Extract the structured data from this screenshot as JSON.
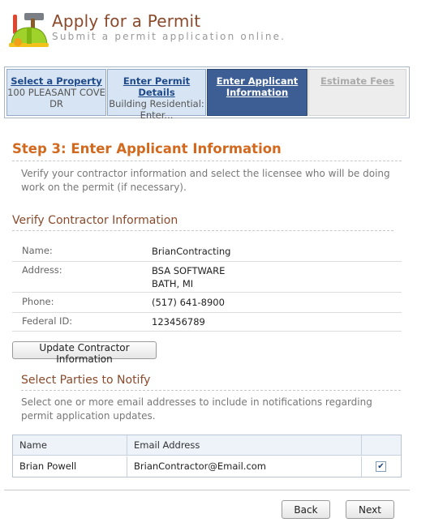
{
  "header": {
    "title": "Apply for a Permit",
    "subtitle": "Submit a permit application online."
  },
  "wizard": {
    "steps": [
      {
        "label": "Select a Property",
        "sub": "100 PLEASANT COVE DR",
        "state": "done"
      },
      {
        "label": "Enter Permit Details",
        "sub": "Building Residential: Enter...",
        "state": "done"
      },
      {
        "label": "Enter Applicant Information",
        "sub": "",
        "state": "active"
      },
      {
        "label": "Estimate Fees",
        "sub": "",
        "state": "future"
      }
    ]
  },
  "step": {
    "heading": "Step 3: Enter Applicant Information",
    "description": "Verify your contractor information and select the licensee who will be doing work on the permit (if necessary)."
  },
  "contractor": {
    "heading": "Verify Contractor Information",
    "rows": [
      {
        "label": "Name:",
        "value": "BrianContracting"
      },
      {
        "label": "Address:",
        "value": "BSA SOFTWARE",
        "value2": "BATH, MI"
      },
      {
        "label": "Phone:",
        "value": "(517) 641-8900"
      },
      {
        "label": "Federal ID:",
        "value": "123456789"
      }
    ],
    "update_button": "Update Contractor Information"
  },
  "notify": {
    "heading": "Select Parties to Notify",
    "description": "Select one or more email addresses to include in notifications regarding permit application updates.",
    "columns": [
      "Name",
      "Email Address"
    ],
    "rows": [
      {
        "name": "Brian Powell",
        "email": "BrianContractor@Email.com",
        "checked": true
      }
    ]
  },
  "nav": {
    "back_label": "Back",
    "next_label": "Next"
  },
  "colors": {
    "accent_orange": "#d2691e",
    "heading_brown": "#8a4a2b",
    "wizard_active": "#3d5e95",
    "wizard_done": "#d7e4f3"
  },
  "icons": {
    "logo": "hardhat-tools-icon",
    "checkbox": "check-icon"
  }
}
